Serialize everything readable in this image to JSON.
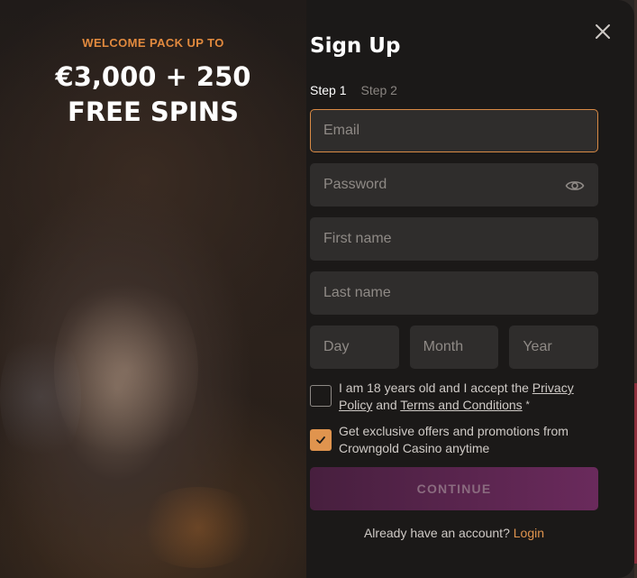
{
  "promo": {
    "kicker": "WELCOME PACK UP TO",
    "headline_line1": "€3,000 + 250",
    "headline_line2": "FREE SPINS"
  },
  "form": {
    "title": "Sign Up",
    "steps": [
      {
        "label": "Step 1",
        "active": true
      },
      {
        "label": "Step 2",
        "active": false
      }
    ],
    "fields": {
      "email": {
        "placeholder": "Email",
        "value": ""
      },
      "password": {
        "placeholder": "Password",
        "value": ""
      },
      "first_name": {
        "placeholder": "First name",
        "value": ""
      },
      "last_name": {
        "placeholder": "Last name",
        "value": ""
      },
      "day": {
        "placeholder": "Day",
        "value": ""
      },
      "month": {
        "placeholder": "Month",
        "value": ""
      },
      "year": {
        "placeholder": "Year",
        "value": ""
      }
    },
    "terms": {
      "checked": false,
      "text_before": "I am 18 years old and I accept the ",
      "privacy_link": "Privacy Policy",
      "text_and": " and ",
      "terms_link": "Terms and Conditions",
      "required_mark": "*"
    },
    "offers": {
      "checked": true,
      "text": "Get exclusive offers and promotions from Crowngold Casino anytime"
    },
    "continue_label": "CONTINUE",
    "login_prompt": "Already have an account?",
    "login_link": "Login"
  },
  "icons": {
    "close": "close-icon",
    "eye": "eye-icon",
    "checkmark": "checkmark-icon"
  },
  "colors": {
    "accent": "#e0944e",
    "modal_bg": "#1b1918",
    "field_bg": "#2f2d2c",
    "button_gradient_start": "#471f3e",
    "button_gradient_end": "#6a2a5c"
  }
}
